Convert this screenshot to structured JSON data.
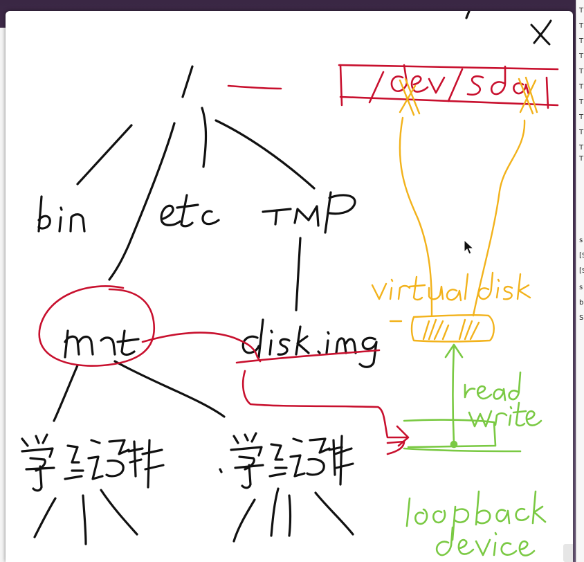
{
  "colors": {
    "ink_black": "#111111",
    "ink_red": "#c8102e",
    "ink_yellow": "#f2b21b",
    "ink_green": "#7ac943",
    "board_bg": "#ffffff"
  },
  "icons": {
    "close": "close-icon",
    "pointer": "mouse-pointer-icon"
  },
  "background_window_fragments": [
    "T",
    "T",
    "T",
    "T",
    "T",
    "T",
    "T",
    "T",
    "T",
    "T",
    "T",
    "s",
    "s",
    "[S",
    "[S",
    "b",
    "S"
  ]
}
